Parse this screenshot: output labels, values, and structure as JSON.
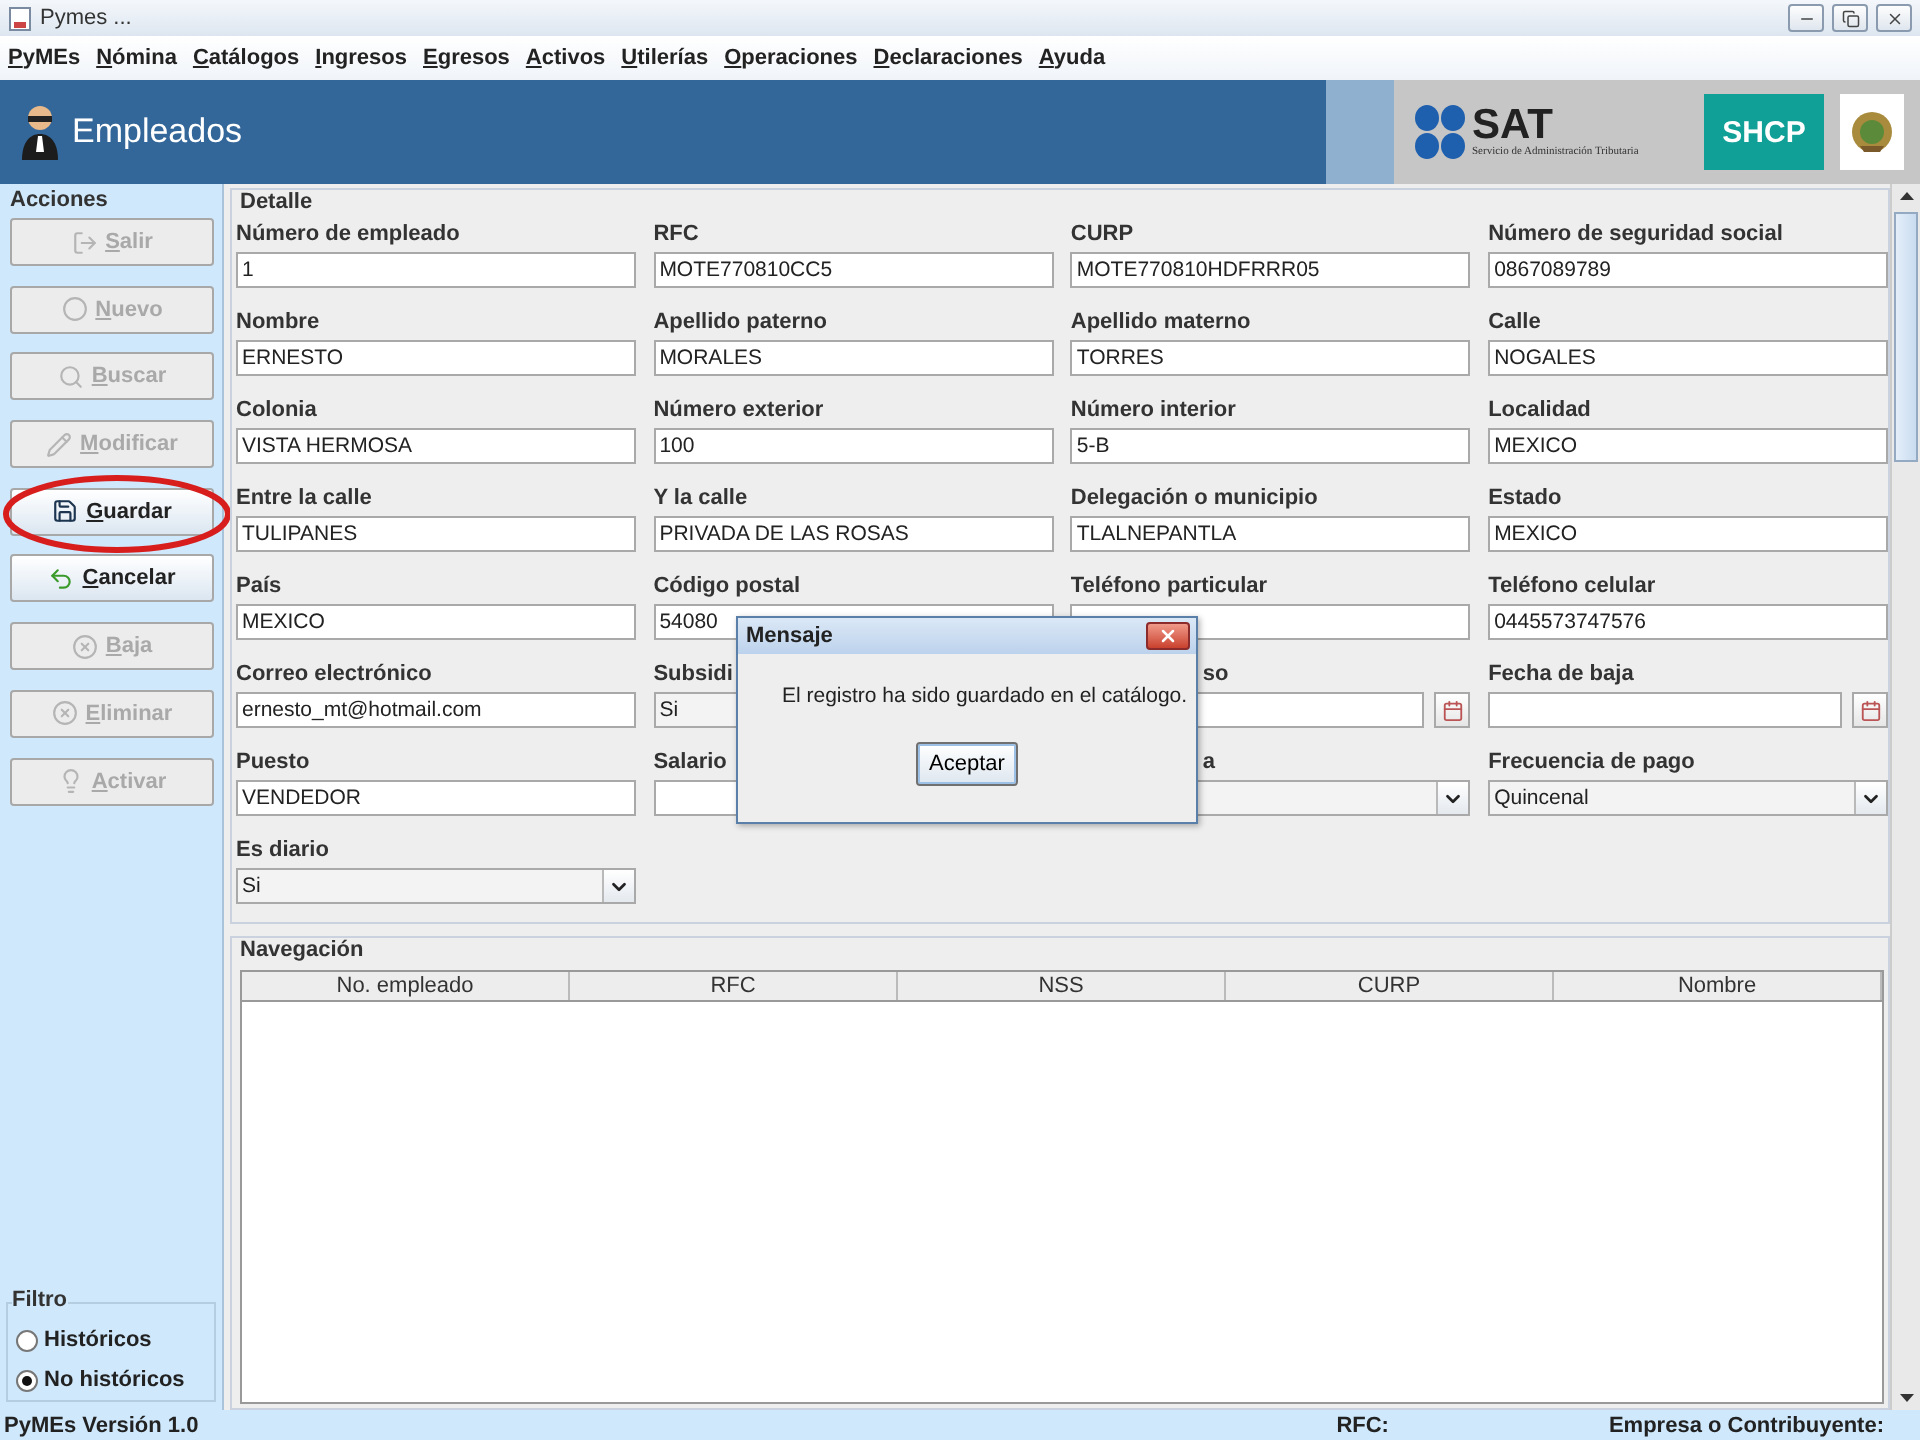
{
  "window": {
    "title": "Pymes ..."
  },
  "menu": [
    "PyMEs",
    "Nómina",
    "Catálogos",
    "Ingresos",
    "Egresos",
    "Activos",
    "Utilerías",
    "Operaciones",
    "Declaraciones",
    "Ayuda"
  ],
  "header": {
    "title": "Empleados",
    "sat_name": "SAT",
    "sat_subtitle": "Servicio de Administración Tributaria",
    "shcp": "SHCP"
  },
  "actions": {
    "title": "Acciones",
    "buttons": [
      {
        "label": "Salir",
        "disabled": true
      },
      {
        "label": "Nuevo",
        "disabled": true
      },
      {
        "label": "Buscar",
        "disabled": true
      },
      {
        "label": "Modificar",
        "disabled": true
      },
      {
        "label": "Guardar",
        "disabled": false,
        "highlighted": true
      },
      {
        "label": "Cancelar",
        "disabled": false
      },
      {
        "label": "Baja",
        "disabled": true
      },
      {
        "label": "Eliminar",
        "disabled": true
      },
      {
        "label": "Activar",
        "disabled": true
      }
    ]
  },
  "filter": {
    "title": "Filtro",
    "options": [
      {
        "label": "Históricos",
        "selected": false
      },
      {
        "label": "No históricos",
        "selected": true
      }
    ]
  },
  "detail": {
    "title": "Detalle",
    "fields": [
      {
        "label": "Número de empleado",
        "value": "1",
        "kind": "text"
      },
      {
        "label": "RFC",
        "value": "MOTE770810CC5",
        "kind": "text"
      },
      {
        "label": "CURP",
        "value": "MOTE770810HDFRRR05",
        "kind": "text"
      },
      {
        "label": "Número de seguridad social",
        "value": "0867089789",
        "kind": "text"
      },
      {
        "label": "Nombre",
        "value": "ERNESTO",
        "kind": "text"
      },
      {
        "label": "Apellido paterno",
        "value": "MORALES",
        "kind": "text"
      },
      {
        "label": "Apellido materno",
        "value": "TORRES",
        "kind": "text"
      },
      {
        "label": "Calle",
        "value": "NOGALES",
        "kind": "text"
      },
      {
        "label": "Colonia",
        "value": "VISTA HERMOSA",
        "kind": "text"
      },
      {
        "label": "Número exterior",
        "value": "100",
        "kind": "text"
      },
      {
        "label": "Número interior",
        "value": "5-B",
        "kind": "text"
      },
      {
        "label": "Localidad",
        "value": "MEXICO",
        "kind": "text"
      },
      {
        "label": "Entre la calle",
        "value": "TULIPANES",
        "kind": "text"
      },
      {
        "label": "Y la calle",
        "value": "PRIVADA DE LAS ROSAS",
        "kind": "text"
      },
      {
        "label": "Delegación o municipio",
        "value": "TLALNEPANTLA",
        "kind": "text"
      },
      {
        "label": "Estado",
        "value": "MEXICO",
        "kind": "text"
      },
      {
        "label": "País",
        "value": "MEXICO",
        "kind": "text"
      },
      {
        "label": "Código postal",
        "value": "54080",
        "kind": "text"
      },
      {
        "label": "Teléfono particular",
        "kind": "text"
      },
      {
        "label": "Teléfono celular",
        "value": "0445573747576",
        "kind": "text"
      },
      {
        "label": "Correo electrónico",
        "value": "ernesto_mt@hotmail.com",
        "kind": "text"
      },
      {
        "label": "Subsidi",
        "value": "Si",
        "kind": "partial"
      },
      {
        "label": "so",
        "kind": "date",
        "covered_at_start": true
      },
      {
        "label": "Fecha de baja",
        "kind": "date"
      },
      {
        "label": "Puesto",
        "value": "VENDEDOR",
        "kind": "text"
      },
      {
        "label": "Salario",
        "kind": "text"
      },
      {
        "label": "a",
        "kind": "combo",
        "covered_at_start": true
      },
      {
        "label": "Frecuencia de pago",
        "value": "Quincenal",
        "kind": "combo"
      },
      {
        "label": "Es diario",
        "value": "Si",
        "kind": "combo"
      }
    ]
  },
  "navigation": {
    "title": "Navegación",
    "columns": [
      "No. empleado",
      "RFC",
      "NSS",
      "CURP",
      "Nombre"
    ]
  },
  "dialog": {
    "title": "Mensaje",
    "message": "El registro ha sido guardado en el catálogo.",
    "button": "Aceptar"
  },
  "status_bar": {
    "version": "PyMEs Versión 1.0",
    "rfc": "RFC:",
    "company": "Empresa o Contribuyente:"
  }
}
